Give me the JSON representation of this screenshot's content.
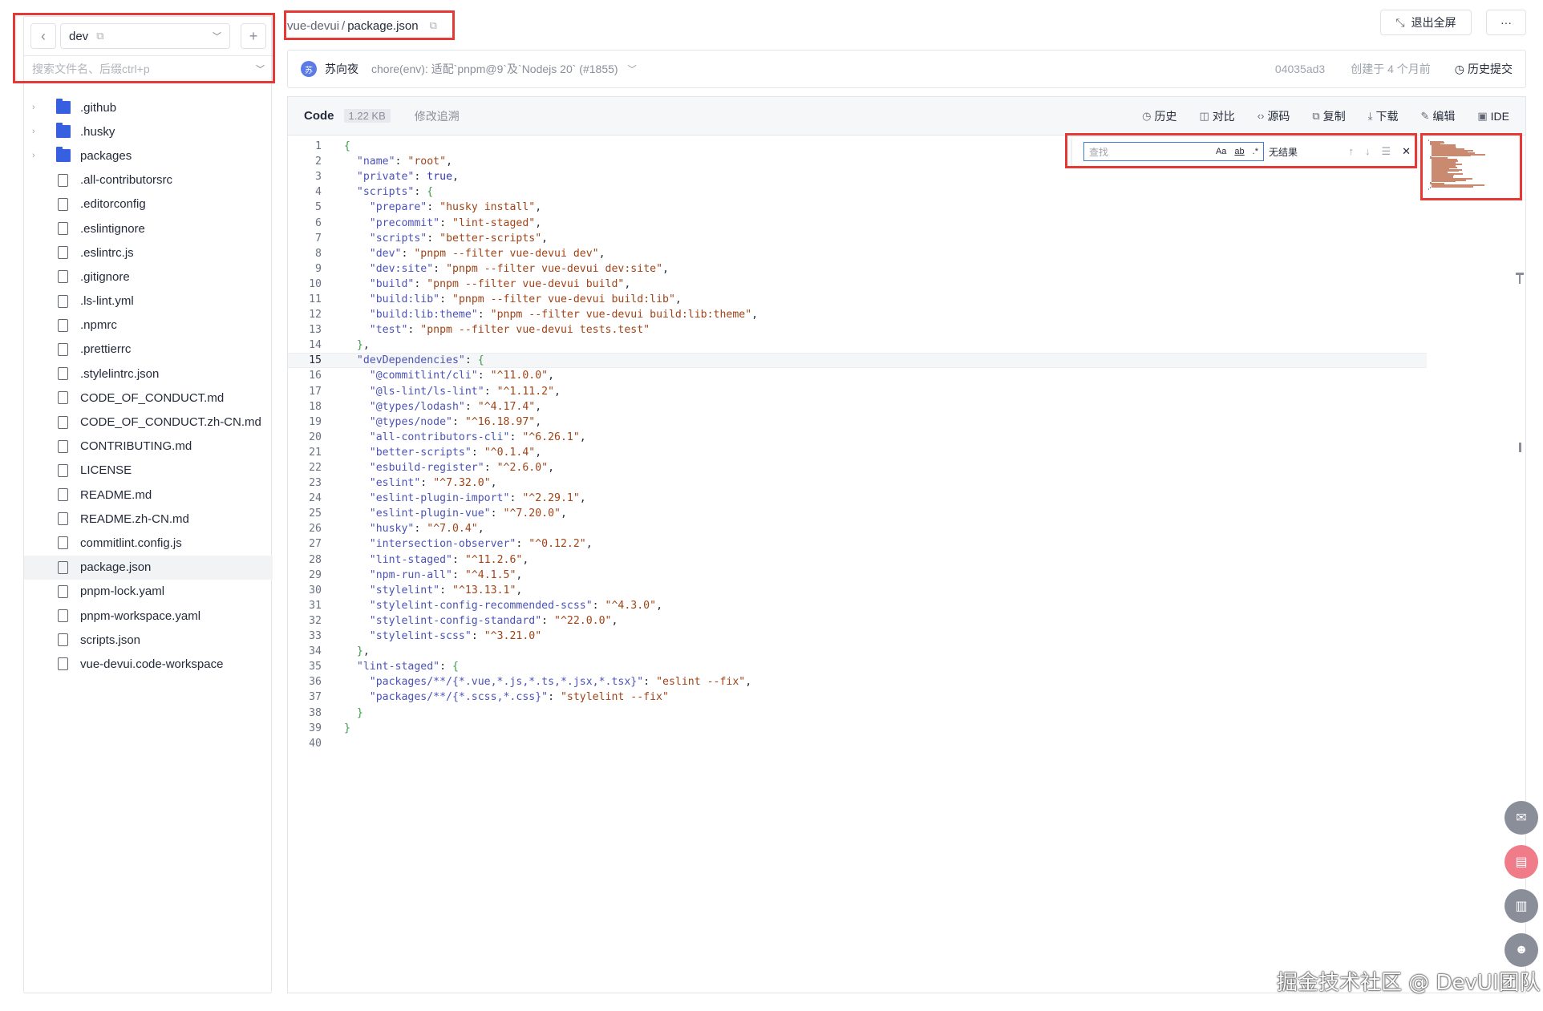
{
  "sidebar": {
    "back_icon": "chevron-left-icon",
    "branch": "dev",
    "add_icon": "plus-icon",
    "search_placeholder": "搜索文件名、后缀ctrl+p",
    "items": [
      {
        "name": ".github",
        "type": "folder"
      },
      {
        "name": ".husky",
        "type": "folder"
      },
      {
        "name": "packages",
        "type": "folder"
      },
      {
        "name": ".all-contributorsrc",
        "type": "file"
      },
      {
        "name": ".editorconfig",
        "type": "file"
      },
      {
        "name": ".eslintignore",
        "type": "file"
      },
      {
        "name": ".eslintrc.js",
        "type": "file"
      },
      {
        "name": ".gitignore",
        "type": "file"
      },
      {
        "name": ".ls-lint.yml",
        "type": "file"
      },
      {
        "name": ".npmrc",
        "type": "file"
      },
      {
        "name": ".prettierrc",
        "type": "file"
      },
      {
        "name": ".stylelintrc.json",
        "type": "file"
      },
      {
        "name": "CODE_OF_CONDUCT.md",
        "type": "file"
      },
      {
        "name": "CODE_OF_CONDUCT.zh-CN.md",
        "type": "file"
      },
      {
        "name": "CONTRIBUTING.md",
        "type": "file"
      },
      {
        "name": "LICENSE",
        "type": "file"
      },
      {
        "name": "README.md",
        "type": "file"
      },
      {
        "name": "README.zh-CN.md",
        "type": "file"
      },
      {
        "name": "commitlint.config.js",
        "type": "file"
      },
      {
        "name": "package.json",
        "type": "file",
        "active": true
      },
      {
        "name": "pnpm-lock.yaml",
        "type": "file"
      },
      {
        "name": "pnpm-workspace.yaml",
        "type": "file"
      },
      {
        "name": "scripts.json",
        "type": "file"
      },
      {
        "name": "vue-devui.code-workspace",
        "type": "file"
      }
    ]
  },
  "breadcrumb": {
    "repo": "vue-devui",
    "separator": "/",
    "file": "package.json"
  },
  "top_actions": {
    "exit_fullscreen": "退出全屏",
    "more": "···"
  },
  "commit": {
    "avatar_initial": "苏",
    "author": "苏向夜",
    "message": "chore(env): 适配`pnpm@9`及`Nodejs 20` (#1855)",
    "hash": "04035ad3",
    "created": "创建于 4 个月前",
    "history": "历史提交"
  },
  "code_header": {
    "tab": "Code",
    "size": "1.22 KB",
    "blame": "修改追溯",
    "tools": [
      {
        "icon": "clock-icon",
        "label": "历史"
      },
      {
        "icon": "compare-icon",
        "label": "对比"
      },
      {
        "icon": "code-icon",
        "label": "源码"
      },
      {
        "icon": "copy-icon",
        "label": "复制"
      },
      {
        "icon": "download-icon",
        "label": "下载"
      },
      {
        "icon": "edit-icon",
        "label": "编辑"
      },
      {
        "icon": "ide-icon",
        "label": "IDE"
      }
    ]
  },
  "find_widget": {
    "placeholder": "查找",
    "match_case": "Aa",
    "whole_word": "ab",
    "regex": ".*",
    "status": "无结果"
  },
  "code": {
    "current_line": 15,
    "lines": [
      "{",
      "  \"name\": \"root\",",
      "  \"private\": true,",
      "  \"scripts\": {",
      "    \"prepare\": \"husky install\",",
      "    \"precommit\": \"lint-staged\",",
      "    \"scripts\": \"better-scripts\",",
      "    \"dev\": \"pnpm --filter vue-devui dev\",",
      "    \"dev:site\": \"pnpm --filter vue-devui dev:site\",",
      "    \"build\": \"pnpm --filter vue-devui build\",",
      "    \"build:lib\": \"pnpm --filter vue-devui build:lib\",",
      "    \"build:lib:theme\": \"pnpm --filter vue-devui build:lib:theme\",",
      "    \"test\": \"pnpm --filter vue-devui tests.test\"",
      "  },",
      "  \"devDependencies\": {",
      "    \"@commitlint/cli\": \"^11.0.0\",",
      "    \"@ls-lint/ls-lint\": \"^1.11.2\",",
      "    \"@types/lodash\": \"^4.17.4\",",
      "    \"@types/node\": \"^16.18.97\",",
      "    \"all-contributors-cli\": \"^6.26.1\",",
      "    \"better-scripts\": \"^0.1.4\",",
      "    \"esbuild-register\": \"^2.6.0\",",
      "    \"eslint\": \"^7.32.0\",",
      "    \"eslint-plugin-import\": \"^2.29.1\",",
      "    \"eslint-plugin-vue\": \"^7.20.0\",",
      "    \"husky\": \"^7.0.4\",",
      "    \"intersection-observer\": \"^0.12.2\",",
      "    \"lint-staged\": \"^11.2.6\",",
      "    \"npm-run-all\": \"^4.1.5\",",
      "    \"stylelint\": \"^13.13.1\",",
      "    \"stylelint-config-recommended-scss\": \"^4.3.0\",",
      "    \"stylelint-config-standard\": \"^22.0.0\",",
      "    \"stylelint-scss\": \"^3.21.0\"",
      "  },",
      "  \"lint-staged\": {",
      "    \"packages/**/{*.vue,*.js,*.ts,*.jsx,*.tsx}\": \"eslint --fix\",",
      "    \"packages/**/{*.scss,*.css}\": \"stylelint --fix\"",
      "  }",
      "}",
      ""
    ]
  },
  "floating_buttons": [
    "mail-icon",
    "survey-icon",
    "docs-icon",
    "smile-icon"
  ],
  "watermark": "掘金技术社区 @ DevUI团队",
  "colors": {
    "highlight_box": "#e53935",
    "folder": "#3660e0",
    "key": "#4b53b8",
    "string": "#a04317"
  }
}
